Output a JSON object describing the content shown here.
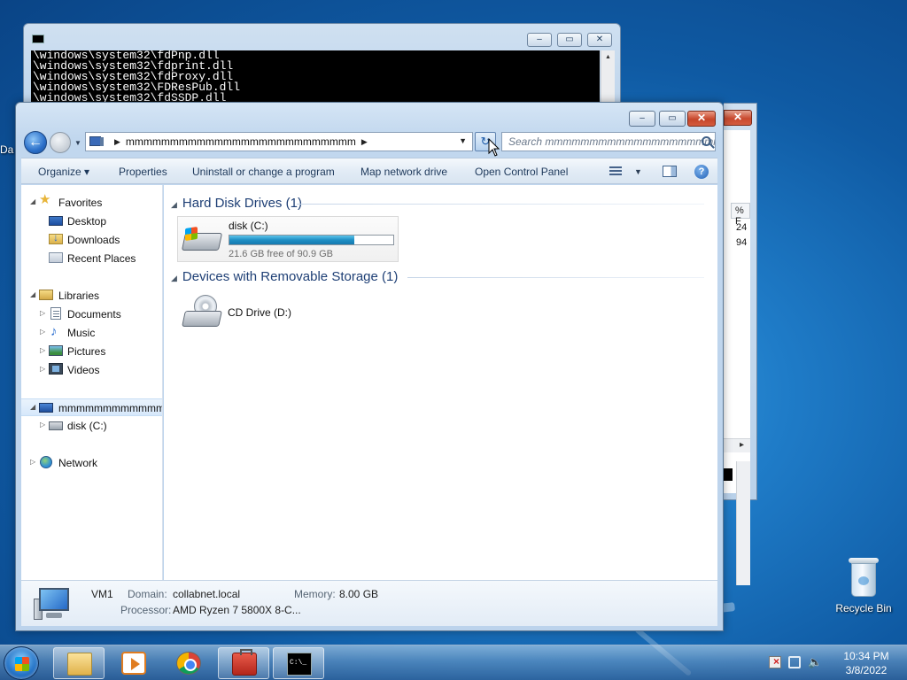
{
  "desktop": {
    "left_label": "Da",
    "recycle_bin": "Recycle Bin"
  },
  "cmd_window": {
    "lines": [
      "\\windows\\system32\\fdPnp.dll",
      "\\windows\\system32\\fdprint.dll",
      "\\windows\\system32\\fdProxy.dll",
      "\\windows\\system32\\FDResPub.dll",
      "\\windows\\system32\\fdSSDP.dll"
    ]
  },
  "bg_window": {
    "column_header": "% F",
    "values": [
      "24",
      "94"
    ]
  },
  "explorer": {
    "address": {
      "breadcrumb": "mmmmmmmmmmmmmmmmmmmmmmmmmm",
      "search_placeholder": "Search mmmmmmmmmmmmmmmmmmmm..."
    },
    "toolbar": {
      "organize": "Organize ▾",
      "properties": "Properties",
      "uninstall": "Uninstall or change a program",
      "map_drive": "Map network drive",
      "control_panel": "Open Control Panel"
    },
    "nav": {
      "favorites": "Favorites",
      "desktop": "Desktop",
      "downloads": "Downloads",
      "recent_places": "Recent Places",
      "libraries": "Libraries",
      "documents": "Documents",
      "music": "Music",
      "pictures": "Pictures",
      "videos": "Videos",
      "computer": "mmmmmmmmmmmmmmmmm",
      "disk_c": "disk (C:)",
      "network": "Network"
    },
    "groups": {
      "hdd_header": "Hard Disk Drives (1)",
      "removable_header": "Devices with Removable Storage (1)"
    },
    "drives": {
      "disk_c": {
        "name": "disk (C:)",
        "free_text": "21.6 GB free of 90.9 GB",
        "used_fraction": 0.76
      },
      "cd": {
        "name": "CD Drive (D:)"
      }
    },
    "details": {
      "computer_name": "VM1",
      "domain_label": "Domain:",
      "domain_value": "collabnet.local",
      "memory_label": "Memory:",
      "memory_value": "8.00 GB",
      "processor_label": "Processor:",
      "processor_value": "AMD Ryzen 7 5800X 8-C..."
    }
  },
  "taskbar": {
    "time": "10:34 PM",
    "date": "3/8/2022"
  }
}
